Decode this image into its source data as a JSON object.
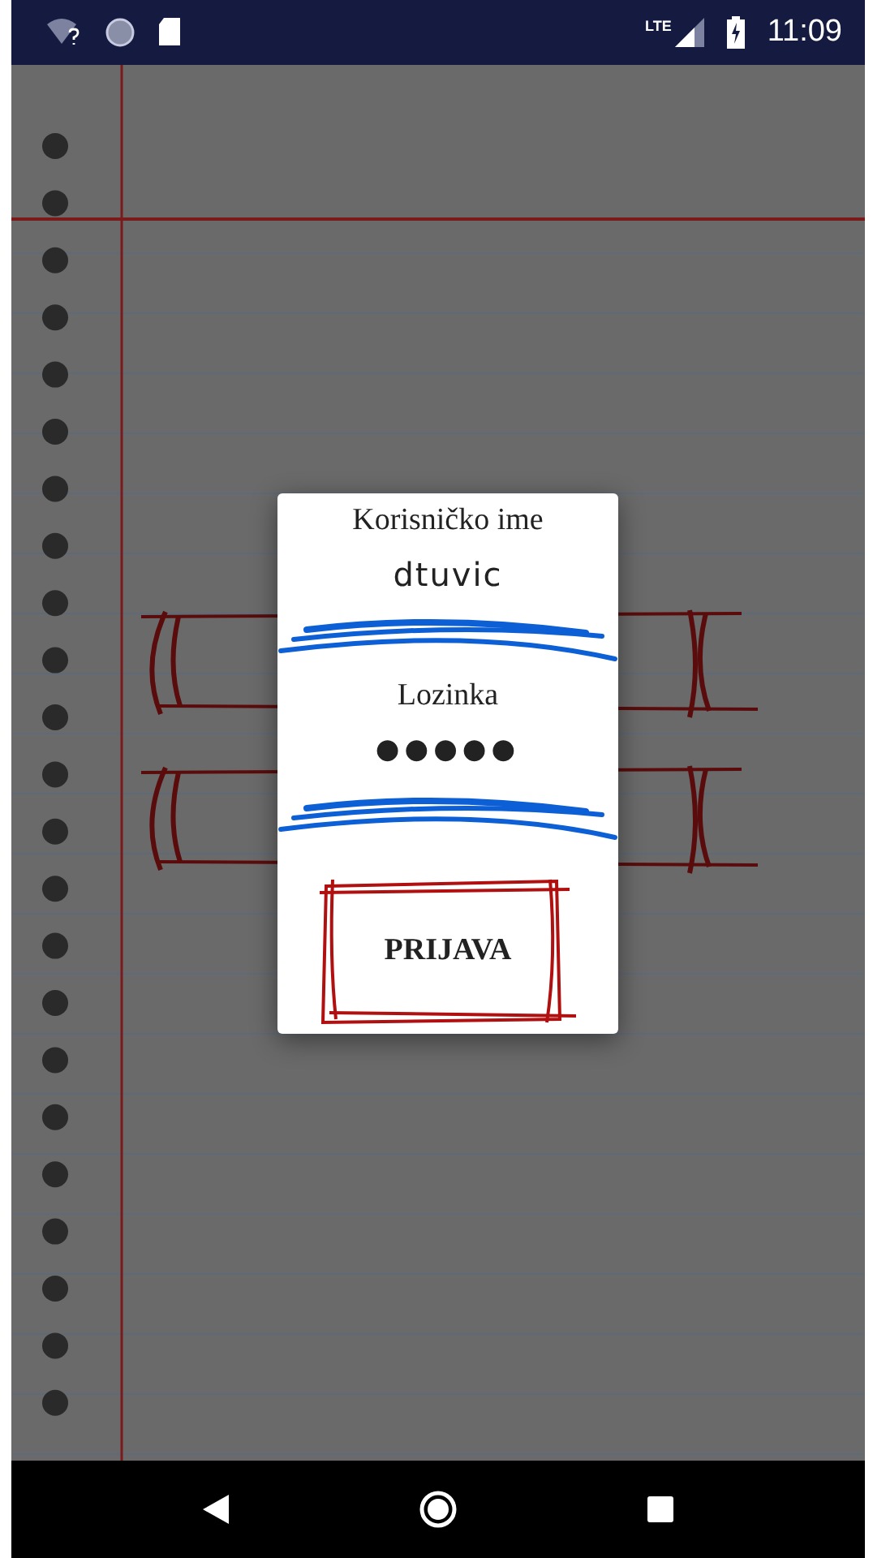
{
  "status_bar": {
    "network": "LTE",
    "time": "11:09"
  },
  "dialog": {
    "username_label": "Korisničko ime",
    "username_value": "dtuvic",
    "password_label": "Lozinka",
    "password_value": "●●●●●",
    "button": "PRIJAVA"
  }
}
